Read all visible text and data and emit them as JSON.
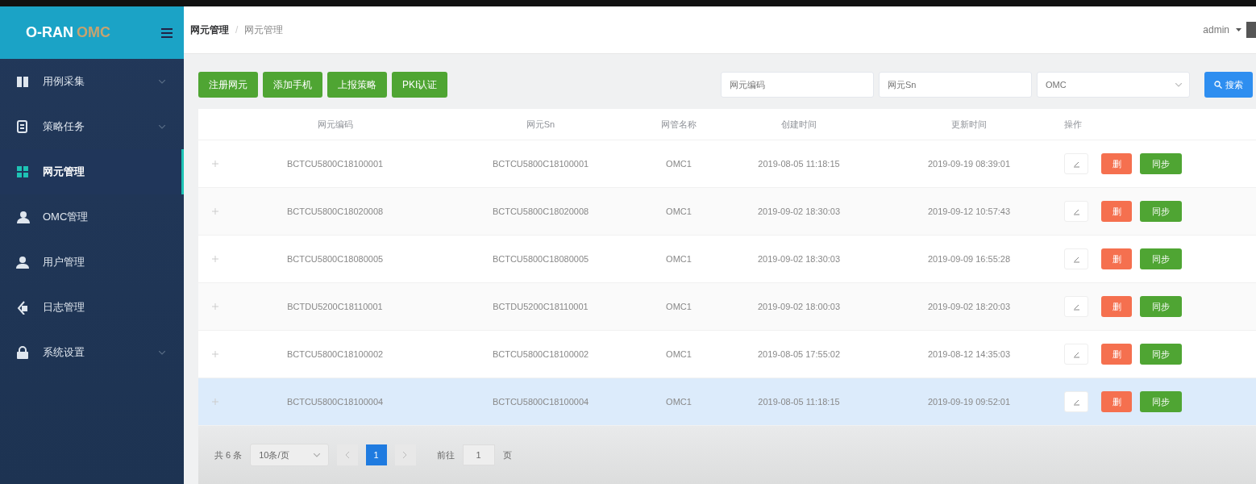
{
  "sidebar": {
    "logo": {
      "main": "O-RAN",
      "accent": "OMC"
    },
    "items": [
      {
        "label": "用例采集",
        "has_submenu": true,
        "selected": false
      },
      {
        "label": "策略任务",
        "has_submenu": true,
        "selected": false
      },
      {
        "label": "网元管理",
        "has_submenu": false,
        "selected": true
      },
      {
        "label": "OMC管理",
        "has_submenu": false,
        "selected": false
      },
      {
        "label": "用户管理",
        "has_submenu": false,
        "selected": false
      },
      {
        "label": "日志管理",
        "has_submenu": false,
        "selected": false
      },
      {
        "label": "系统设置",
        "has_submenu": true,
        "selected": false
      }
    ]
  },
  "header": {
    "breadcrumb": [
      "网元管理",
      "网元管理"
    ],
    "breadcrumb_separator": "/",
    "user": "admin"
  },
  "toolbar": {
    "buttons": [
      "注册网元",
      "添加手机",
      "上报策略",
      "PKI认证"
    ],
    "filters": [
      {
        "kind": "text",
        "placeholder": "网元编码"
      },
      {
        "kind": "text",
        "placeholder": "网元Sn"
      },
      {
        "kind": "select",
        "placeholder": "OMC"
      }
    ],
    "search_button": "搜索"
  },
  "table": {
    "columns": [
      "网元编码",
      "网元Sn",
      "网管名称",
      "创建时间",
      "更新时间",
      "操作"
    ],
    "rows": [
      {
        "cells": [
          "BCTCU5800C18100001",
          "BCTCU5800C18100001",
          "OMC1",
          "2019-08-05 11:18:15",
          "2019-09-19 08:39:01"
        ],
        "selected": false,
        "delete_label": "删",
        "sync_label": "同步"
      },
      {
        "cells": [
          "BCTCU5800C18020008",
          "BCTCU5800C18020008",
          "OMC1",
          "2019-09-02 18:30:03",
          "2019-09-12 10:57:43"
        ],
        "selected": false,
        "delete_label": "删",
        "sync_label": "同步"
      },
      {
        "cells": [
          "BCTCU5800C18080005",
          "BCTCU5800C18080005",
          "OMC1",
          "2019-09-02 18:30:03",
          "2019-09-09 16:55:28"
        ],
        "selected": false,
        "delete_label": "删",
        "sync_label": "同步"
      },
      {
        "cells": [
          "BCTDU5200C18110001",
          "BCTDU5200C18110001",
          "OMC1",
          "2019-09-02 18:00:03",
          "2019-09-02 18:20:03"
        ],
        "selected": false,
        "delete_label": "删",
        "sync_label": "同步"
      },
      {
        "cells": [
          "BCTCU5800C18100002",
          "BCTCU5800C18100002",
          "OMC1",
          "2019-08-05 17:55:02",
          "2019-08-12 14:35:03"
        ],
        "selected": false,
        "delete_label": "删",
        "sync_label": "同步"
      },
      {
        "cells": [
          "BCTCU5800C18100004",
          "BCTCU5800C18100004",
          "OMC1",
          "2019-08-05 11:18:15",
          "2019-09-19 09:52:01"
        ],
        "selected": true,
        "delete_label": "删",
        "sync_label": "同步"
      }
    ]
  },
  "pagination": {
    "total": "共 6 条",
    "page_size": "10条/页",
    "pages": [
      {
        "label": "1",
        "selected": true
      }
    ],
    "goto_label": "前往",
    "goto_value": "1",
    "goto_suffix": "页"
  }
}
